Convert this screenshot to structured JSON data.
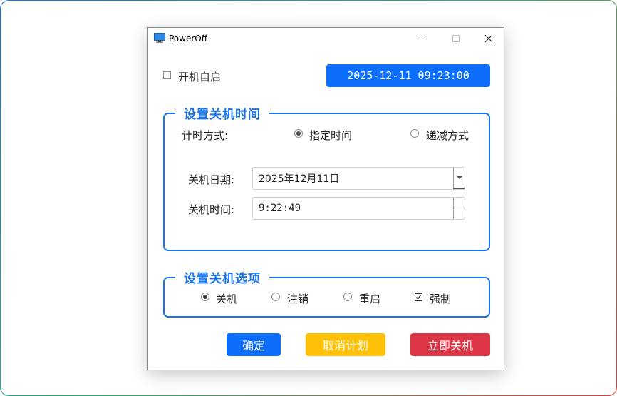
{
  "window": {
    "title": "PowerOff"
  },
  "autostart": {
    "label": "开机自启",
    "checked": false
  },
  "clock": {
    "text": "2025-12-11 09:23:00"
  },
  "schedule_group": {
    "title": "设置关机时间",
    "mode_label": "计时方式:",
    "modes": [
      {
        "label": "指定时间",
        "selected": true
      },
      {
        "label": "递减方式",
        "selected": false
      }
    ],
    "date_label": "关机日期:",
    "date_value": "2025年12月11日",
    "time_label": "关机时间:",
    "time_value": "9:22:49"
  },
  "options_group": {
    "title": "设置关机选项",
    "actions": [
      {
        "label": "关机",
        "selected": true
      },
      {
        "label": "注销",
        "selected": false
      },
      {
        "label": "重启",
        "selected": false
      }
    ],
    "force": {
      "label": "强制",
      "checked": true
    }
  },
  "buttons": {
    "confirm": "确定",
    "cancel_plan": "取消计划",
    "shutdown_now": "立即关机"
  },
  "colors": {
    "accent": "#1a73e8",
    "clock_bg": "#0d6efd",
    "confirm_bg": "#0d6efd",
    "cancel_bg": "#ffc107",
    "shutdown_bg": "#dc3545"
  }
}
